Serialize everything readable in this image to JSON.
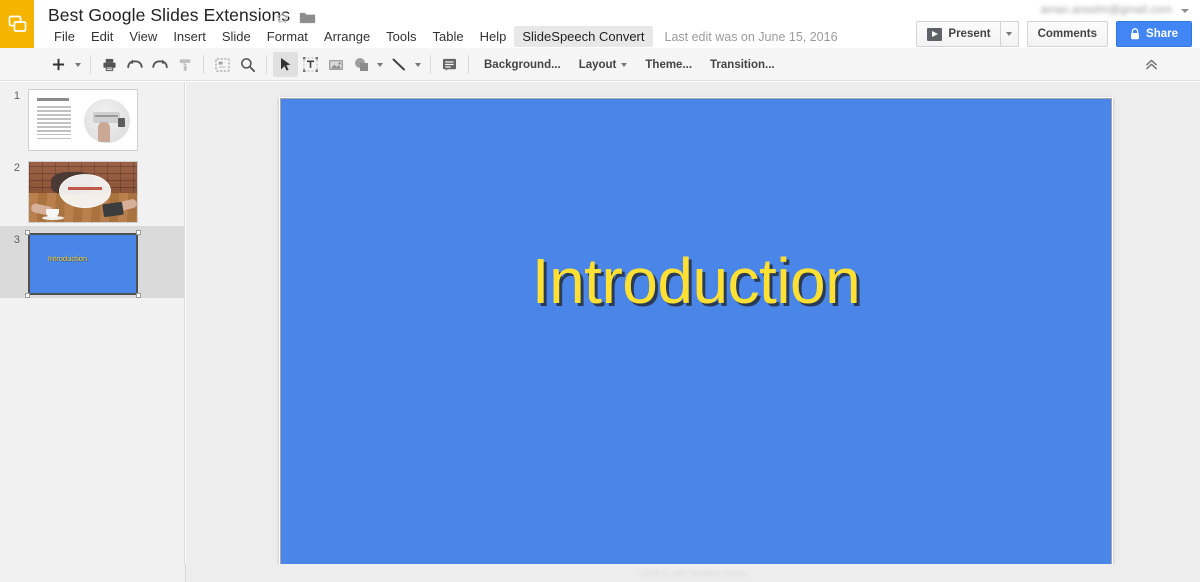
{
  "app": {
    "name": "Google Slides",
    "logo_icon": "google-slides-logo-icon",
    "logo_color": "#F4B400"
  },
  "header": {
    "document_title": "Best Google Slides Extensions",
    "star_icon": "star-outline-icon",
    "folder_icon": "folder-icon",
    "account_email": "aman.anselm@gmail.com",
    "account_caret_icon": "chevron-down-icon",
    "menus": [
      {
        "label": "File",
        "active": false
      },
      {
        "label": "Edit",
        "active": false
      },
      {
        "label": "View",
        "active": false
      },
      {
        "label": "Insert",
        "active": false
      },
      {
        "label": "Slide",
        "active": false
      },
      {
        "label": "Format",
        "active": false
      },
      {
        "label": "Arrange",
        "active": false
      },
      {
        "label": "Tools",
        "active": false
      },
      {
        "label": "Table",
        "active": false
      },
      {
        "label": "Help",
        "active": false
      },
      {
        "label": "SlideSpeech Convert",
        "active": true
      }
    ],
    "last_edit": "Last edit was on June 15, 2016",
    "present_label": "Present",
    "present_icon": "play-rectangle-icon",
    "present_caret_icon": "chevron-down-icon",
    "comments_label": "Comments",
    "share_label": "Share",
    "share_icon": "lock-icon",
    "share_color": "#4285f4"
  },
  "toolbar": {
    "new_slide_icon": "plus-icon",
    "new_slide_caret_icon": "chevron-down-icon",
    "print_icon": "printer-icon",
    "undo_icon": "undo-arrow-icon",
    "redo_icon": "redo-arrow-icon",
    "paint_format_icon": "paint-roller-icon",
    "fit_icon": "fit-to-screen-icon",
    "zoom_icon": "magnifier-icon",
    "select_icon": "cursor-arrow-icon",
    "textbox_icon": "text-box-icon",
    "image_icon": "image-icon",
    "shape_icon": "shape-icon",
    "shape_caret_icon": "chevron-down-icon",
    "line_icon": "line-icon",
    "line_caret_icon": "chevron-down-icon",
    "comment_icon": "add-comment-icon",
    "background_label": "Background...",
    "layout_label": "Layout",
    "layout_caret_icon": "chevron-down-icon",
    "theme_label": "Theme...",
    "transition_label": "Transition...",
    "collapse_icon": "double-chevron-up-icon"
  },
  "filmstrip": {
    "slides": [
      {
        "number": "1",
        "kind": "text-with-image",
        "selected": false
      },
      {
        "number": "2",
        "kind": "photo",
        "selected": false
      },
      {
        "number": "3",
        "kind": "title",
        "title": "Introduction",
        "selected": true
      }
    ]
  },
  "canvas": {
    "slide_number": "3",
    "slide_background_color": "#4a86E8",
    "title_text": "Introduction",
    "title_color": "#ffe033",
    "title_shadow_color": "#1e1e1e"
  },
  "notes": {
    "placeholder": "Click to add speaker notes"
  }
}
